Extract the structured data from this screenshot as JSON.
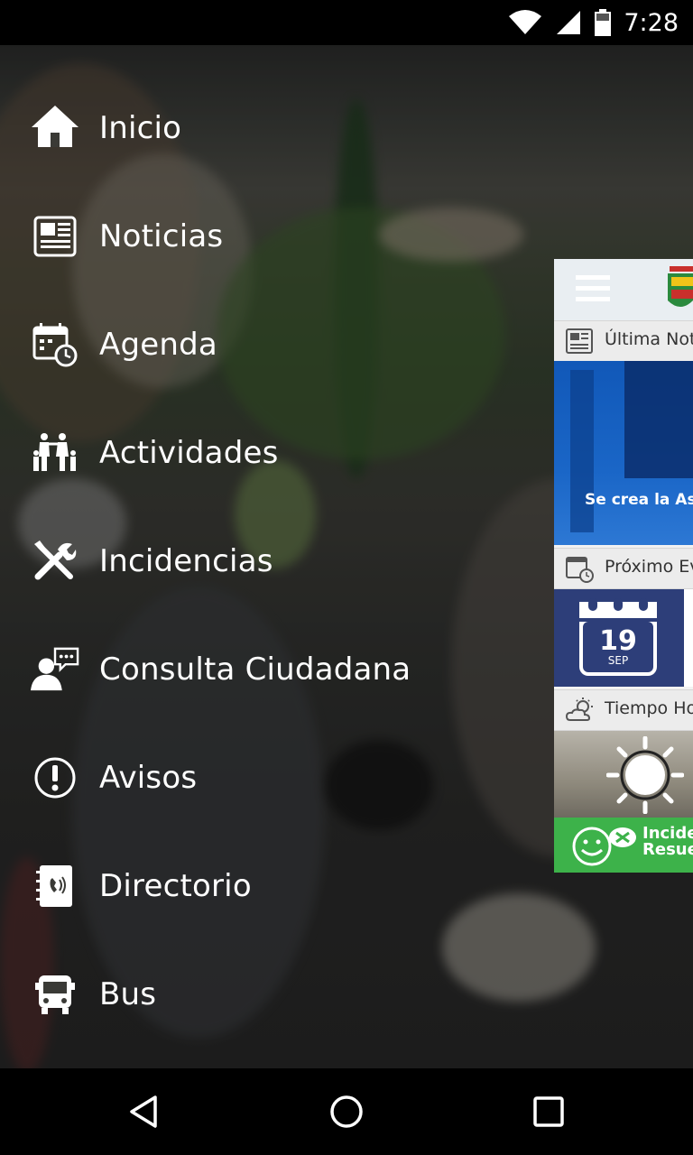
{
  "status_bar": {
    "time": "7:28",
    "icons": [
      "wifi-icon",
      "signal-icon",
      "battery-icon"
    ]
  },
  "menu": {
    "items": [
      {
        "label": "Inicio",
        "icon": "home-icon"
      },
      {
        "label": "Noticias",
        "icon": "newspaper-icon"
      },
      {
        "label": "Agenda",
        "icon": "calendar-clock-icon"
      },
      {
        "label": "Actividades",
        "icon": "family-icon"
      },
      {
        "label": "Incidencias",
        "icon": "tools-icon"
      },
      {
        "label": "Consulta Ciudadana",
        "icon": "citizen-chat-icon"
      },
      {
        "label": "Avisos",
        "icon": "alert-icon"
      },
      {
        "label": "Directorio",
        "icon": "phone-directory-icon"
      },
      {
        "label": "Bus",
        "icon": "bus-icon"
      }
    ]
  },
  "preview_card": {
    "sections": {
      "news_title": "Última Not",
      "news_caption": "Se crea la Aso",
      "events_title": "Próximo Ev",
      "event_day": "19",
      "event_month": "SEP",
      "weather_title": "Tiempo Ho",
      "incidents_line1": "Incide",
      "incidents_line2": "Resue"
    }
  },
  "nav_bar": {
    "buttons": [
      "back-icon",
      "home-circle-icon",
      "recents-icon"
    ]
  },
  "colors": {
    "menu_text": "#ffffff",
    "card_blue": "#1a66c7",
    "event_navy": "#2d3e79",
    "incidents_green": "#3db24a"
  }
}
